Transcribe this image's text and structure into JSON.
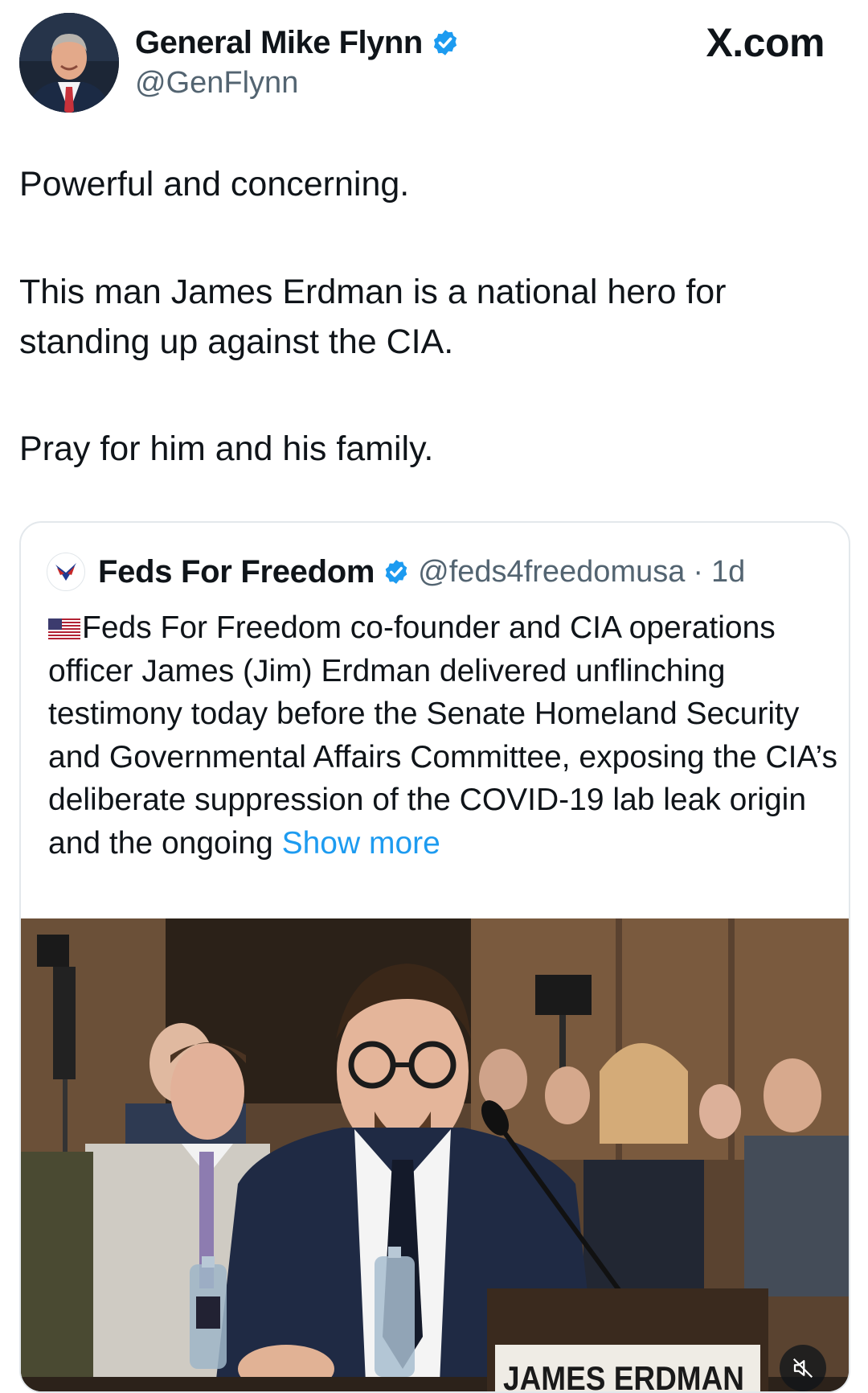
{
  "author": {
    "name": "General Mike Flynn",
    "handle": "@GenFlynn",
    "verified": true,
    "avatar_icon": "profile-photo"
  },
  "site_label": "X.com",
  "post": {
    "line1": "Powerful and concerning.",
    "line2": "This man James Erdman is a national hero for standing up against the CIA.",
    "line3": "Pray for him and his family."
  },
  "quoted": {
    "name": "Feds For Freedom",
    "handle": "@feds4freedomusa",
    "separator": "·",
    "time": "1d",
    "verified": true,
    "logo_icon": "eagle-logo",
    "flag_icon": "us-flag-icon",
    "text": "Feds For Freedom co-founder and CIA operations officer James (Jim) Erdman delivered unflinching testimony today before the Senate Homeland Security and Governmental Affairs Committee, exposing the CIA’s deliberate suppression of the COVID-19 lab leak origin and the ongoing",
    "show_more": "Show more",
    "media": {
      "nameplate": "JAMES ERDMAN",
      "mute_icon": "muted-speaker-icon"
    }
  },
  "colors": {
    "verified_blue": "#1d9bf0",
    "link_blue": "#1d9bf0",
    "secondary_text": "#536471"
  }
}
